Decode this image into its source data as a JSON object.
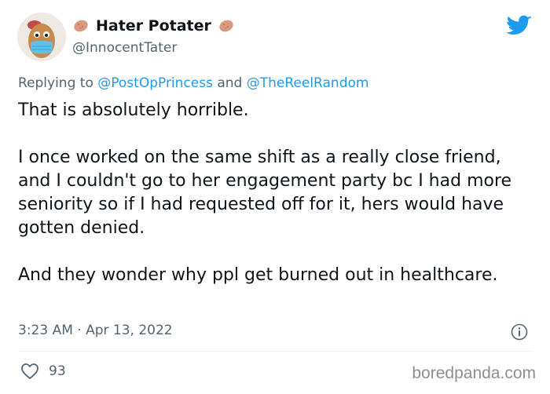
{
  "author": {
    "display_name": "Hater Potater",
    "handle": "@InnocentTater",
    "avatar_icon": "potato-with-mask-avatar"
  },
  "reply": {
    "prefix": "Replying to ",
    "mention_1": "@PostOpPrincess",
    "joiner": " and ",
    "mention_2": "@TheReelRandom"
  },
  "body": {
    "para_1": "That is absolutely horrible.",
    "para_2": "I once worked on the same shift as a really close friend, and I couldn't go to her engagement party bc I had more seniority so if I had requested off for it, hers would have gotten denied.",
    "para_3": "And they wonder why ppl get burned out in healthcare."
  },
  "meta": {
    "timestamp": "3:23 AM · Apr 13, 2022"
  },
  "engagement": {
    "likes": "93"
  },
  "watermark": "boredpanda.com",
  "colors": {
    "twitter_blue": "#1d9bf0",
    "secondary_text": "#536471",
    "primary_text": "#0f1419"
  }
}
